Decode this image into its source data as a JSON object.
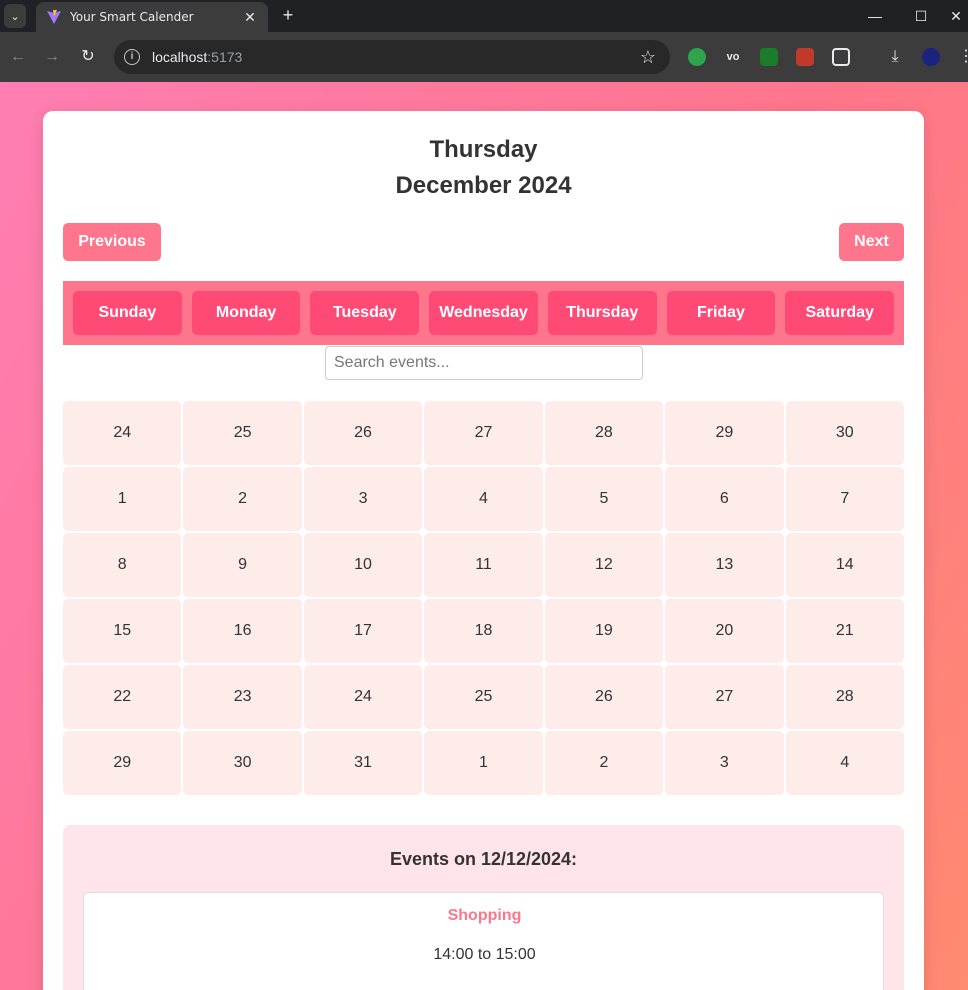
{
  "browser": {
    "tab_title": "Your Smart Calender",
    "url_host": "localhost",
    "url_port": ":5173"
  },
  "header": {
    "day_name": "Thursday",
    "month_year": "December 2024"
  },
  "nav": {
    "previous_label": "Previous",
    "next_label": "Next"
  },
  "weekdays": [
    "Sunday",
    "Monday",
    "Tuesday",
    "Wednesday",
    "Thursday",
    "Friday",
    "Saturday"
  ],
  "search": {
    "placeholder": "Search events...",
    "value": ""
  },
  "calendar_days": [
    "24",
    "25",
    "26",
    "27",
    "28",
    "29",
    "30",
    "1",
    "2",
    "3",
    "4",
    "5",
    "6",
    "7",
    "8",
    "9",
    "10",
    "11",
    "12",
    "13",
    "14",
    "15",
    "16",
    "17",
    "18",
    "19",
    "20",
    "21",
    "22",
    "23",
    "24",
    "25",
    "26",
    "27",
    "28",
    "29",
    "30",
    "31",
    "1",
    "2",
    "3",
    "4"
  ],
  "events_panel": {
    "title": "Events on 12/12/2024:",
    "events": [
      {
        "name": "Shopping",
        "time": "14:00 to 15:00"
      }
    ]
  },
  "colors": {
    "accent": "#ff758c",
    "weekday_button": "#ff4a75",
    "day_cell": "#fdecea",
    "events_bg": "#ffe4ea"
  }
}
